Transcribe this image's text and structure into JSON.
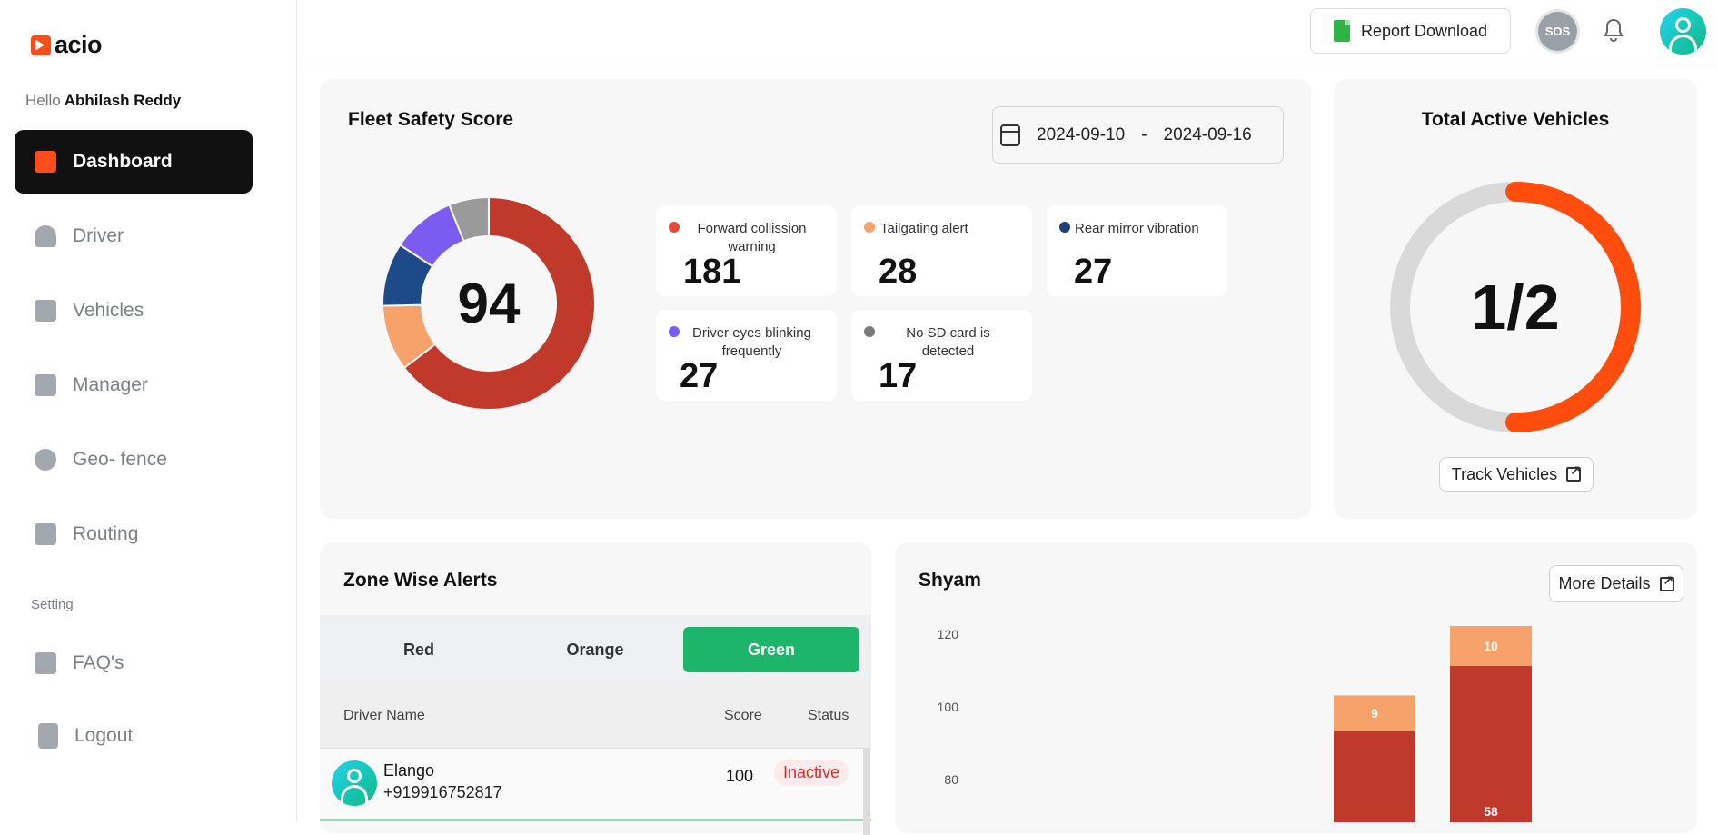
{
  "sidebar": {
    "logo_text": "acio",
    "greeting": "Hello",
    "user_name": "Abhilash Reddy",
    "items": [
      {
        "label": "Dashboard",
        "icon": "chart-bar-icon",
        "active": true
      },
      {
        "label": "Driver",
        "icon": "user-icon"
      },
      {
        "label": "Vehicles",
        "icon": "truck-icon"
      },
      {
        "label": "Manager",
        "icon": "manager-icon"
      },
      {
        "label": "Geo- fence",
        "icon": "map-pin-icon"
      },
      {
        "label": "Routing",
        "icon": "route-icon"
      }
    ],
    "section_label": "Setting",
    "settings": [
      {
        "label": "FAQ's",
        "icon": "layers-icon"
      },
      {
        "label": "Logout",
        "icon": "logout-icon"
      }
    ]
  },
  "header": {
    "report_label": "Report Download",
    "sos_label": "SOS"
  },
  "fleet": {
    "title": "Fleet Safety Score",
    "date_from": "2024-09-10",
    "date_sep": "-",
    "date_to": "2024-09-16",
    "score": "94",
    "stats": [
      {
        "label": "Forward collission warning",
        "value": "181",
        "color": "#e04a3a"
      },
      {
        "label": "Tailgating alert",
        "value": "28",
        "color": "#f7a26b"
      },
      {
        "label": "Rear mirror vibration",
        "value": "27",
        "color": "#1f3f7a"
      },
      {
        "label": "Driver eyes blinking frequently",
        "value": "27",
        "color": "#7c5cf0"
      },
      {
        "label": "No SD card is detected",
        "value": "17",
        "color": "#7a7a7a"
      }
    ],
    "donut_colors": [
      "#c0392b",
      "#f7a26b",
      "#1e4a8a",
      "#7c5cf0",
      "#9a9a9a"
    ]
  },
  "active": {
    "title": "Total Active Vehicles",
    "ratio": "1/2",
    "fraction": 0.5,
    "track_label": "Track Vehicles",
    "ring_color": "#ff4d0d",
    "track_color": "#d9d9d9"
  },
  "zone": {
    "title": "Zone Wise Alerts",
    "tabs": [
      {
        "label": "Red"
      },
      {
        "label": "Orange"
      },
      {
        "label": "Green",
        "active": true
      }
    ],
    "columns": [
      "Driver Name",
      "Score",
      "Status"
    ],
    "rows": [
      {
        "name": "Elango",
        "phone": "+919916752817",
        "score": "100",
        "status": "Inactive"
      }
    ]
  },
  "shyam": {
    "title": "Shyam",
    "more_label": "More Details"
  },
  "chart_data": {
    "type": "bar",
    "title": "Shyam",
    "ylim": [
      60,
      120
    ],
    "yticks": [
      "120",
      "100",
      "80"
    ],
    "series": [
      {
        "color": "#c0392b",
        "values": [
          null,
          58
        ]
      },
      {
        "color": "#f7a26b",
        "values": [
          9,
          10
        ]
      }
    ],
    "bar_labels": [
      "9",
      "10",
      "58"
    ]
  }
}
